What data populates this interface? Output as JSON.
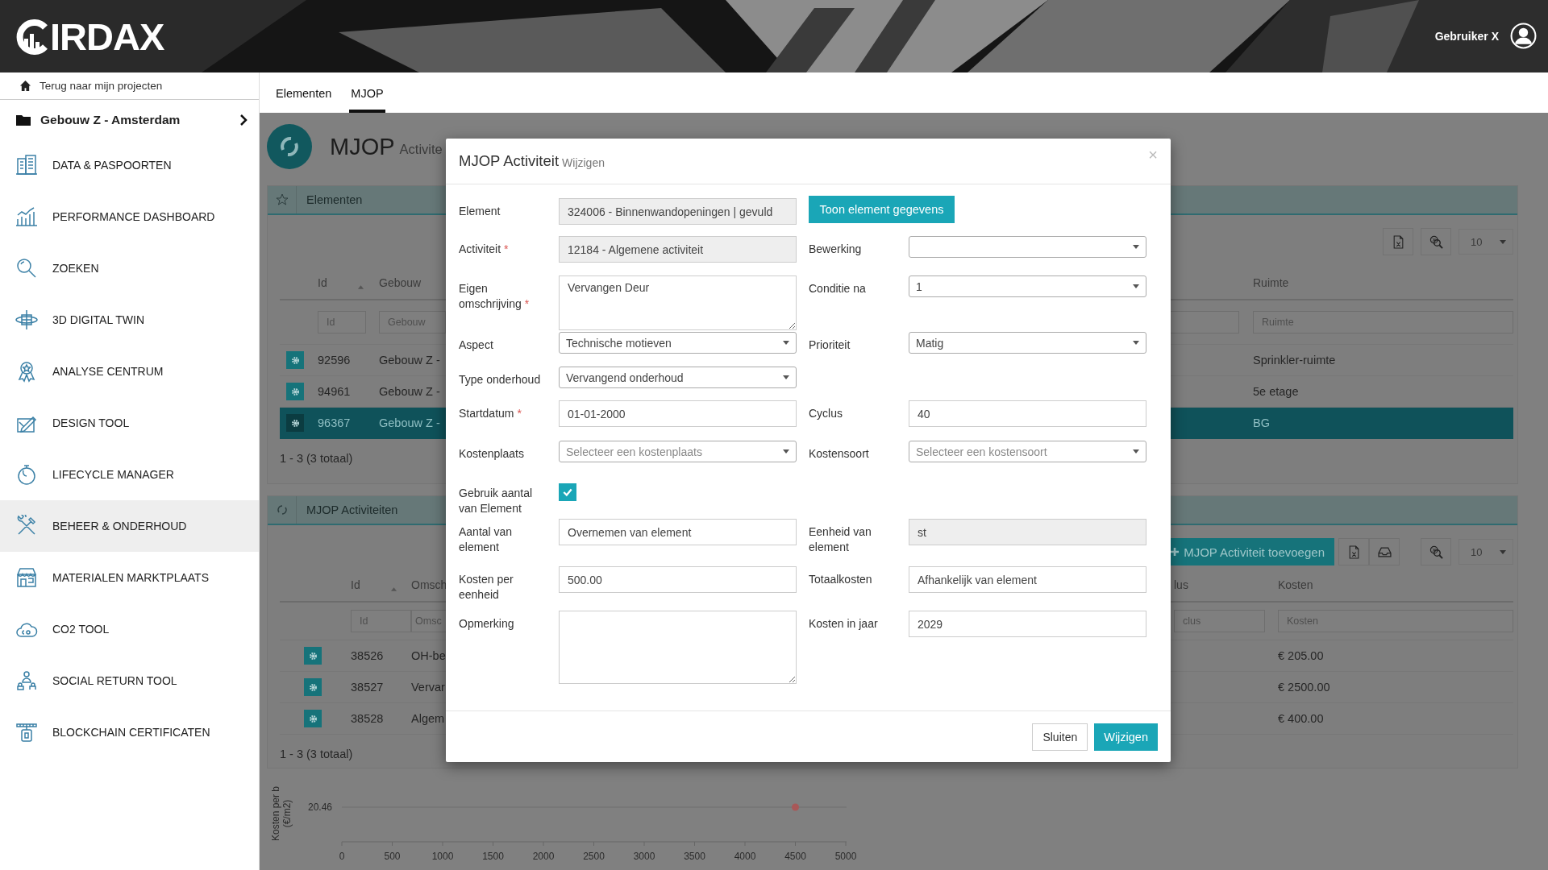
{
  "header": {
    "brand": "IRDAX",
    "user": "Gebruiker X"
  },
  "sidebar": {
    "back_link": "Terug naar mijn projecten",
    "project": "Gebouw Z - Amsterdam",
    "items": [
      {
        "label": "DATA & PASPOORTEN",
        "selected": false
      },
      {
        "label": "PERFORMANCE DASHBOARD",
        "selected": false
      },
      {
        "label": "ZOEKEN",
        "selected": false
      },
      {
        "label": "3D DIGITAL TWIN",
        "selected": false
      },
      {
        "label": "ANALYSE CENTRUM",
        "selected": false
      },
      {
        "label": "DESIGN TOOL",
        "selected": false
      },
      {
        "label": "LIFECYCLE MANAGER",
        "selected": false
      },
      {
        "label": "BEHEER & ONDERHOUD",
        "selected": true
      },
      {
        "label": "MATERIALEN MARKTPLAATS",
        "selected": false
      },
      {
        "label": "CO2 TOOL",
        "selected": false
      },
      {
        "label": "SOCIAL RETURN TOOL",
        "selected": false
      },
      {
        "label": "BLOCKCHAIN CERTIFICATEN",
        "selected": false
      }
    ]
  },
  "tabs": [
    {
      "label": "Elementen",
      "selected": false
    },
    {
      "label": "MJOP",
      "selected": true
    }
  ],
  "page": {
    "title": "MJOP",
    "subtitle": "Activite"
  },
  "elements_panel": {
    "title": "Elementen",
    "page_size": "10",
    "columns": [
      "Id",
      "Gebouw",
      "Ruimte"
    ],
    "filter_placeholders": [
      "Id",
      "Gebouw",
      "Ruimte"
    ],
    "rows": [
      {
        "id": "92596",
        "building": "Gebouw Z -",
        "room": "Sprinkler-ruimte",
        "selected": false
      },
      {
        "id": "94961",
        "building": "Gebouw Z -",
        "room": "5e etage",
        "selected": false
      },
      {
        "id": "96367",
        "building": "Gebouw Z -",
        "room": "BG",
        "selected": true
      }
    ],
    "footer": "1 - 3 (3 totaal)"
  },
  "activities_panel": {
    "title": "MJOP Activiteiten",
    "add_button": "MJOP Activiteit toevoegen",
    "page_size": "10",
    "columns": [
      "Id",
      "Omsch",
      "lus",
      "Kosten"
    ],
    "filter_placeholders": [
      "Id",
      "Omsc",
      "clus",
      "Kosten"
    ],
    "rows": [
      {
        "id": "38526",
        "description": "OH-be",
        "cost": "€ 205.00"
      },
      {
        "id": "38527",
        "description": "Vervar",
        "cost": "€ 2500.00"
      },
      {
        "id": "38528",
        "description": "Algem",
        "cost": "€ 400.00"
      }
    ],
    "footer": "1 - 3 (3 totaal)"
  },
  "chart": {
    "y_axis_title": "Kosten per b (€/m2)",
    "y_value_label": "20.46",
    "x_tick_labels": [
      "0",
      "500",
      "1000",
      "1500",
      "2000",
      "2500",
      "3000",
      "3500",
      "4000",
      "4500",
      "5000"
    ]
  },
  "modal": {
    "title": "MJOP Activiteit",
    "subtitle": "Wijzigen",
    "close": "×",
    "rows": [
      {
        "left": {
          "label": "Element",
          "kind": "text",
          "value": "324006 - Binnenwandopeningen | gevuld",
          "disabled": true
        },
        "right": {
          "kind": "button",
          "label": "Toon element gegevens"
        }
      },
      {
        "left": {
          "label": "Activiteit",
          "required_mark": "*",
          "kind": "text",
          "value": "12184 - Algemene activiteit",
          "disabled": true
        },
        "right": {
          "label": "Bewerking",
          "kind": "select"
        }
      },
      {
        "left": {
          "label": "Eigen omschrijving",
          "required_mark": "*",
          "kind": "textarea",
          "value": "Vervangen Deur"
        },
        "right": {
          "label": "Conditie na",
          "kind": "select",
          "value": "1"
        }
      },
      {
        "left": {
          "label": "Aspect",
          "kind": "select",
          "value": "Technische motieven"
        },
        "right": {
          "label": "Prioriteit",
          "kind": "select",
          "value": "Matig"
        }
      },
      {
        "left": {
          "label": "Type onderhoud",
          "kind": "select",
          "value": "Vervangend onderhoud"
        }
      },
      {
        "left": {
          "label": "Startdatum",
          "required_mark": "*",
          "kind": "text",
          "value": "01-01-2000",
          "disabled": false
        },
        "right": {
          "label": "Cyclus",
          "kind": "text",
          "value": "40",
          "disabled": false
        }
      },
      {
        "left": {
          "label": "Kostenplaats",
          "kind": "select",
          "placeholder": "Selecteer een kostenplaats"
        },
        "right": {
          "label": "Kostensoort",
          "kind": "select",
          "placeholder": "Selecteer een kostensoort"
        }
      },
      {
        "left": {
          "label": "Gebruik aantal van Element",
          "kind": "checkbox",
          "checked": true
        }
      },
      {
        "left": {
          "label": "Aantal van element",
          "kind": "text",
          "value": "Overnemen van element",
          "disabled": false
        },
        "right": {
          "label": "Eenheid van element",
          "kind": "text",
          "value": "st",
          "disabled": true
        }
      },
      {
        "left": {
          "label": "Kosten per eenheid",
          "kind": "text",
          "value": "500.00",
          "disabled": false
        },
        "right": {
          "label": "Totaalkosten",
          "kind": "text",
          "value": "Afhankelijk van element",
          "disabled": false
        }
      },
      {
        "left": {
          "label": "Opmerking",
          "kind": "textarea"
        },
        "right": {
          "label": "Kosten in jaar",
          "kind": "text",
          "value": "2029",
          "disabled": false
        }
      }
    ],
    "buttons": [
      {
        "label": "Sluiten",
        "kind": "secondary"
      },
      {
        "label": "Wijzigen",
        "kind": "primary"
      }
    ]
  }
}
